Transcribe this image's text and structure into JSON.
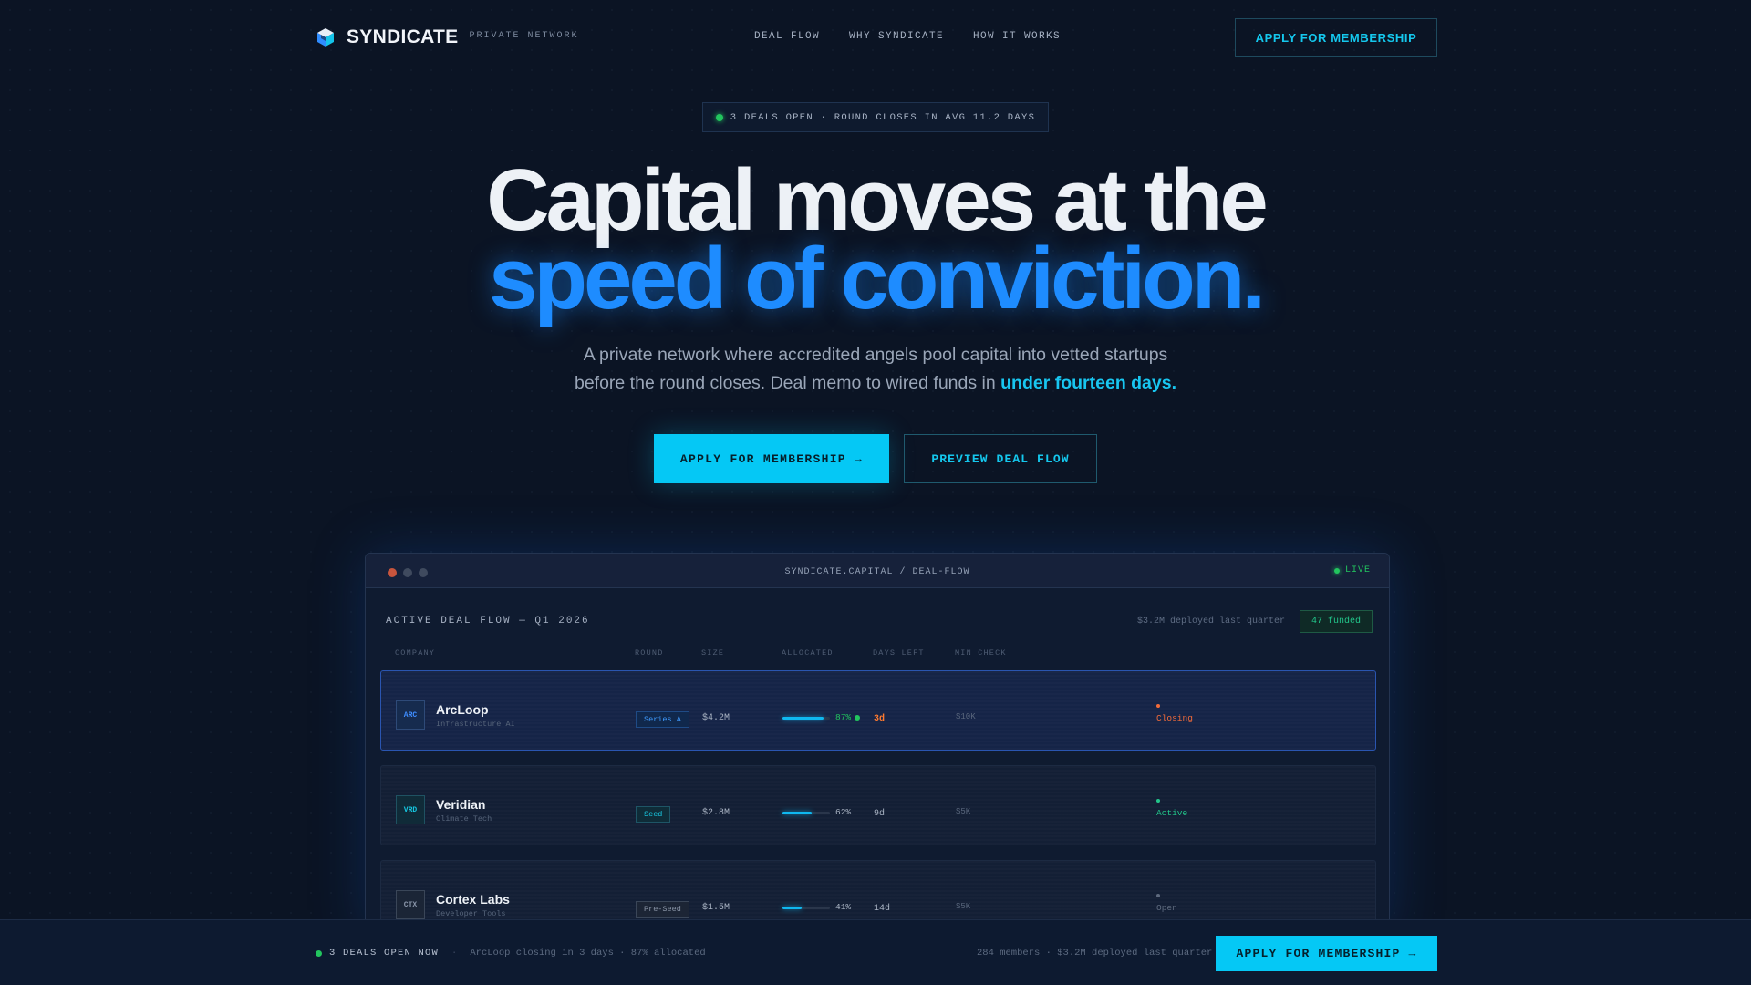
{
  "brand": {
    "name": "SYNDICATE",
    "tagline": "PRIVATE NETWORK",
    "logo_icon": "isometric-cube-icon"
  },
  "nav": {
    "links": [
      "DEAL FLOW",
      "WHY SYNDICATE",
      "HOW IT WORKS"
    ],
    "cta_label": "APPLY FOR MEMBERSHIP"
  },
  "status_badge": {
    "text": "3 DEALS OPEN · ROUND CLOSES IN AVG 11.2 DAYS"
  },
  "hero": {
    "line1": "Capital moves at the",
    "line2": "speed of conviction.",
    "subtitle_part1": "A private network where accredited angels pool capital into vetted startups",
    "subtitle_part2": "before the round closes. Deal memo to wired funds in ",
    "subtitle_highlight": "under fourteen days.",
    "primary_cta": "APPLY FOR MEMBERSHIP →",
    "secondary_cta": "PREVIEW DEAL FLOW"
  },
  "dashboard": {
    "url": "SYNDICATE.CAPITAL / DEAL-FLOW",
    "live_label": "LIVE",
    "title": "ACTIVE DEAL FLOW — Q1 2026",
    "meta": "$3.2M deployed last quarter",
    "funded_badge": "47 funded",
    "columns": [
      "COMPANY",
      "ROUND",
      "SIZE",
      "ALLOCATED",
      "DAYS LEFT",
      "MIN CHECK"
    ],
    "deals": [
      {
        "abbr": "ARC",
        "name": "ArcLoop",
        "sector": "Infrastructure AI",
        "round": "Series A",
        "size": "$4.2M",
        "allocated": 87,
        "allocated_label": "87%",
        "days_left": "3d",
        "min_check": "$10K",
        "status": "Closing"
      },
      {
        "abbr": "VRD",
        "name": "Veridian",
        "sector": "Climate Tech",
        "round": "Seed",
        "size": "$2.8M",
        "allocated": 62,
        "allocated_label": "62%",
        "days_left": "9d",
        "min_check": "$5K",
        "status": "Active"
      },
      {
        "abbr": "CTX",
        "name": "Cortex Labs",
        "sector": "Developer Tools",
        "round": "Pre-Seed",
        "size": "$1.5M",
        "allocated": 41,
        "allocated_label": "41%",
        "days_left": "14d",
        "min_check": "$5K",
        "status": "Open"
      }
    ]
  },
  "footer": {
    "open_label": "3 DEALS OPEN NOW",
    "separator": "·",
    "info": "ArcLoop closing in 3 days · 87% allocated",
    "stats": "284 members · $3.2M deployed last quarter",
    "cta": "APPLY FOR MEMBERSHIP →"
  },
  "colors": {
    "accent": "#05c8f5",
    "headline_blue": "#1e8cff",
    "live_green": "#22c55e",
    "closing_orange": "#f26b3a",
    "background": "#0b1424"
  }
}
